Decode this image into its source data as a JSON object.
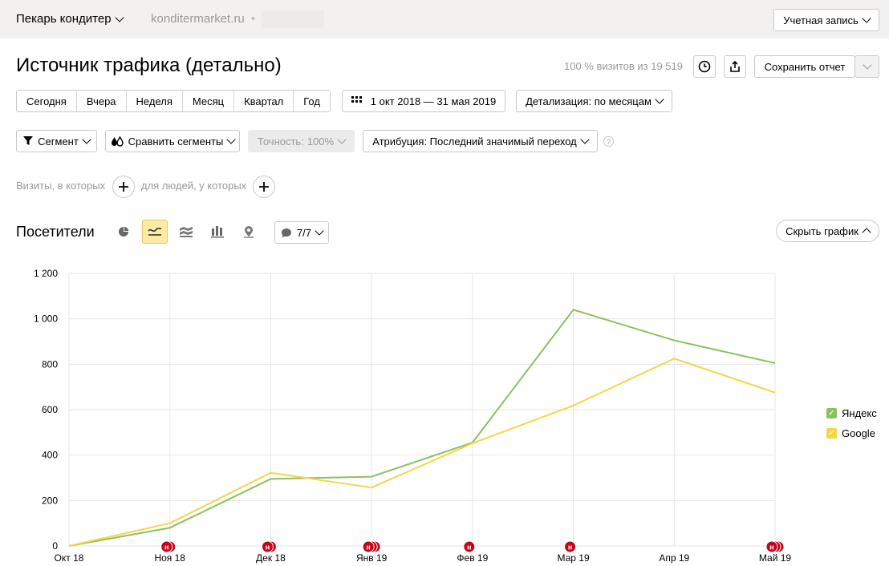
{
  "topbar": {
    "counter_name": "Пекарь кондитер",
    "site": "konditermarket.ru",
    "site_separator": "•",
    "account_label": "Учетная запись"
  },
  "header": {
    "title": "Источник трафика (детально)",
    "visits_share": "100 % визитов из 19 519",
    "save_report_label": "Сохранить отчет"
  },
  "period": {
    "presets": [
      "Сегодня",
      "Вчера",
      "Неделя",
      "Месяц",
      "Квартал",
      "Год"
    ],
    "date_range": "1 окт 2018 — 31 мая 2019",
    "grouping_label": "Детализация: по месяцам"
  },
  "filters": {
    "segment_label": "Сегмент",
    "compare_label": "Сравнить сегменты",
    "accuracy_label": "Точность:",
    "accuracy_value": "100%",
    "attribution_label": "Атрибуция: Последний значимый переход",
    "help_icon_text": "?",
    "visits_condition": "Визиты, в которых",
    "people_condition": "для людей, у которых"
  },
  "chart_section": {
    "title": "Посетители",
    "series_counter": "7/7",
    "hide_chart_label": "Скрыть график"
  },
  "icons": {
    "pie": "pie-chart-icon",
    "line": "line-chart-icon",
    "area": "stacked-area-icon",
    "bar": "bar-chart-icon",
    "map": "map-pin-icon",
    "history": "clock-icon",
    "export": "share-icon"
  },
  "colors": {
    "yandex": "#8cc160",
    "google": "#f5d547",
    "annotation": "#c4041a",
    "active_tool": "#fdeba3"
  },
  "annotation_letter": "н",
  "chart_data": {
    "type": "line",
    "categories": [
      "Окт 18",
      "Ноя 18",
      "Дек 18",
      "Янв 19",
      "Фев 19",
      "Мар 19",
      "Апр 19",
      "Май 19"
    ],
    "series": [
      {
        "name": "Яндекс",
        "values": [
          0,
          80,
          295,
          305,
          455,
          1040,
          905,
          805
        ]
      },
      {
        "name": "Google",
        "values": [
          0,
          100,
          322,
          257,
          452,
          618,
          825,
          675
        ]
      }
    ],
    "ylim": [
      0,
      1200
    ],
    "yticks": [
      0,
      200,
      400,
      600,
      800,
      1000,
      1200
    ],
    "ytick_labels": [
      "0",
      "200",
      "400",
      "600",
      "800",
      "1 000",
      "1 200"
    ],
    "annotation_counts": [
      0,
      2,
      2,
      3,
      1,
      1,
      0,
      3
    ],
    "grid": true,
    "legend": "right"
  }
}
